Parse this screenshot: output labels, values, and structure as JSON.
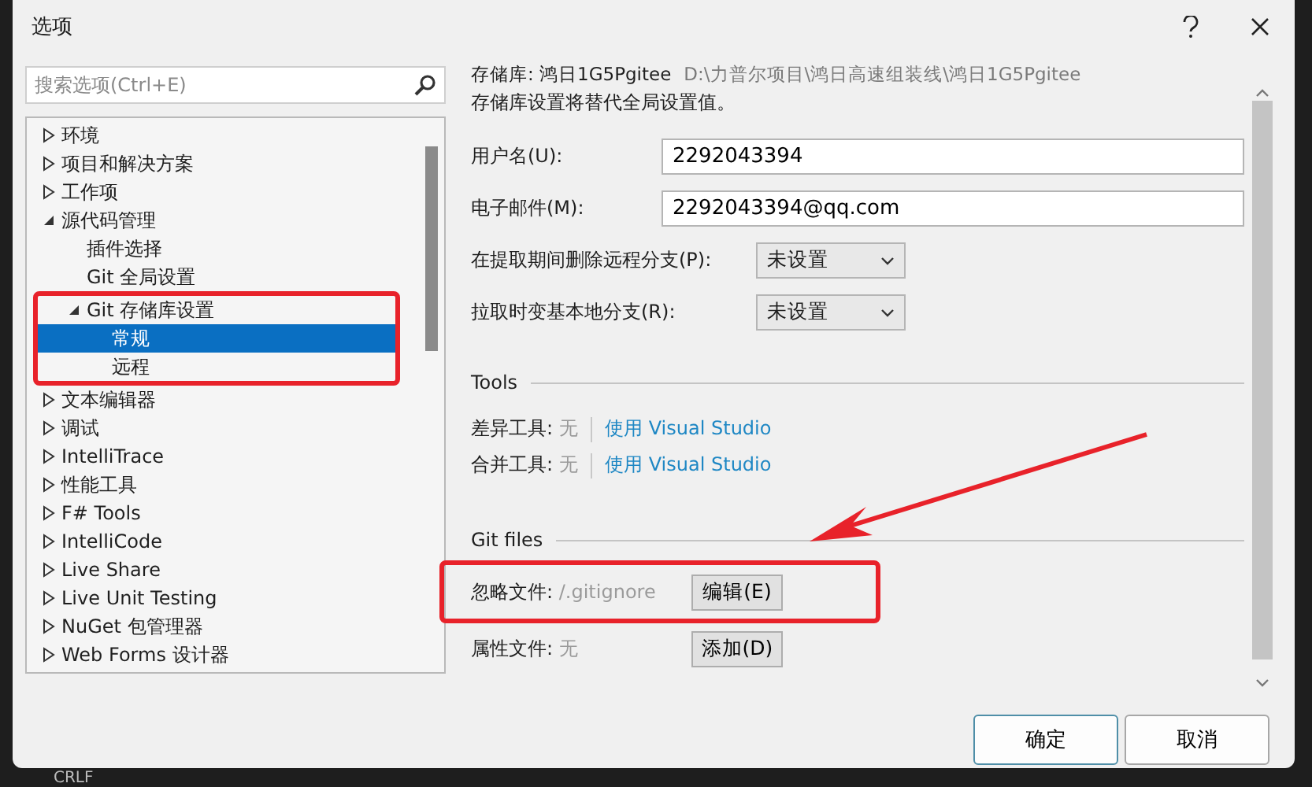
{
  "window": {
    "title": "选项"
  },
  "search": {
    "placeholder": "搜索选项(Ctrl+E)"
  },
  "tree": [
    {
      "label": "环境",
      "expanded": false,
      "selected": false
    },
    {
      "label": "项目和解决方案",
      "expanded": false,
      "selected": false
    },
    {
      "label": "工作项",
      "expanded": false,
      "selected": false
    },
    {
      "label": "源代码管理",
      "expanded": true,
      "selected": false,
      "children": [
        {
          "label": "插件选择",
          "selected": false
        },
        {
          "label": "Git 全局设置",
          "selected": false
        },
        {
          "label": "Git 存储库设置",
          "expanded": true,
          "selected": false,
          "children": [
            {
              "label": "常规",
              "selected": true
            },
            {
              "label": "远程",
              "selected": false
            }
          ]
        }
      ]
    },
    {
      "label": "文本编辑器",
      "expanded": false,
      "selected": false
    },
    {
      "label": "调试",
      "expanded": false,
      "selected": false
    },
    {
      "label": "IntelliTrace",
      "expanded": false,
      "selected": false
    },
    {
      "label": "性能工具",
      "expanded": false,
      "selected": false
    },
    {
      "label": "F# Tools",
      "expanded": false,
      "selected": false
    },
    {
      "label": "IntelliCode",
      "expanded": false,
      "selected": false
    },
    {
      "label": "Live Share",
      "expanded": false,
      "selected": false
    },
    {
      "label": "Live Unit Testing",
      "expanded": false,
      "selected": false
    },
    {
      "label": "NuGet 包管理器",
      "expanded": false,
      "selected": false
    },
    {
      "label": "Web Forms 设计器",
      "expanded": false,
      "selected": false
    }
  ],
  "repository": {
    "label": "存储库: 鸿日1G5Pgitee",
    "path": "D:\\力普尔项目\\鸿日高速组装线\\鸿日1G5Pgitee",
    "note": "存储库设置将替代全局设置值。"
  },
  "fields": [
    {
      "kind": "text",
      "label": "用户名(U):",
      "value": "2292043394"
    },
    {
      "kind": "text",
      "label": "电子邮件(M):",
      "value": "2292043394@qq.com"
    },
    {
      "kind": "dropdown",
      "label": "在提取期间删除远程分支(P):",
      "value": "未设置"
    },
    {
      "kind": "dropdown",
      "label": "拉取时变基本地分支(R):",
      "value": "未设置"
    }
  ],
  "tools": {
    "title": "Tools",
    "rows": [
      {
        "label": "差异工具:",
        "value": "无",
        "link": "使用 Visual Studio"
      },
      {
        "label": "合并工具:",
        "value": "无",
        "link": "使用 Visual Studio"
      }
    ]
  },
  "git_files": {
    "title": "Git files",
    "rows": [
      {
        "label": "忽略文件:",
        "value": "/.gitignore",
        "button": "编辑(E)"
      },
      {
        "label": "属性文件:",
        "value": "无",
        "button": "添加(D)"
      }
    ]
  },
  "buttons": [
    "确定",
    "取消"
  ],
  "status_bar": {
    "text": "CRLF"
  }
}
